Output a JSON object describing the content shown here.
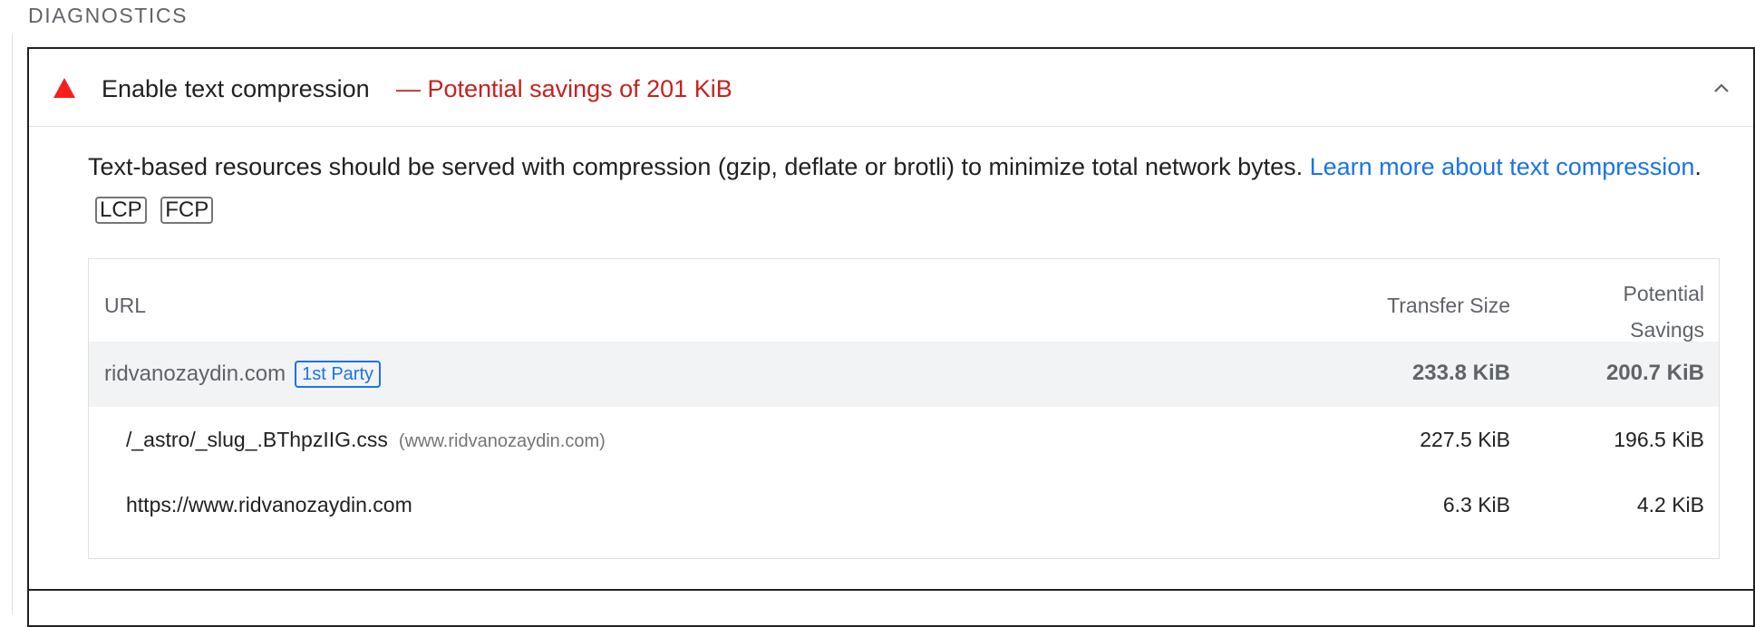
{
  "section": {
    "title": "DIAGNOSTICS"
  },
  "audit": {
    "title": "Enable text compression",
    "savings": "— Potential savings of 201 KiB",
    "status_icon": "warning-triangle-icon",
    "status_color": "#f4201f",
    "expanded": true,
    "description": {
      "text": "Text-based resources should be served with compression (gzip, deflate or brotli) to minimize total network bytes. ",
      "link_text": "Learn more about text compression",
      "after_link": ".",
      "tags": [
        "LCP",
        "FCP"
      ]
    },
    "table": {
      "headers": {
        "url": "URL",
        "transfer_size": "Transfer Size",
        "potential_savings_line1": "Potential",
        "potential_savings_line2": "Savings"
      },
      "group": {
        "entity": "ridvanozaydin.com",
        "badge": "1st Party",
        "transfer_size": "233.8 KiB",
        "potential_savings": "200.7 KiB"
      },
      "rows": [
        {
          "url": "/_astro/_slug_.BThpzIIG.css",
          "host": "(www.ridvanozaydin.com)",
          "transfer_size": "227.5 KiB",
          "potential_savings": "196.5 KiB"
        },
        {
          "url": "https://www.ridvanozaydin.com",
          "host": "",
          "transfer_size": "6.3 KiB",
          "potential_savings": "4.2 KiB"
        }
      ]
    }
  }
}
